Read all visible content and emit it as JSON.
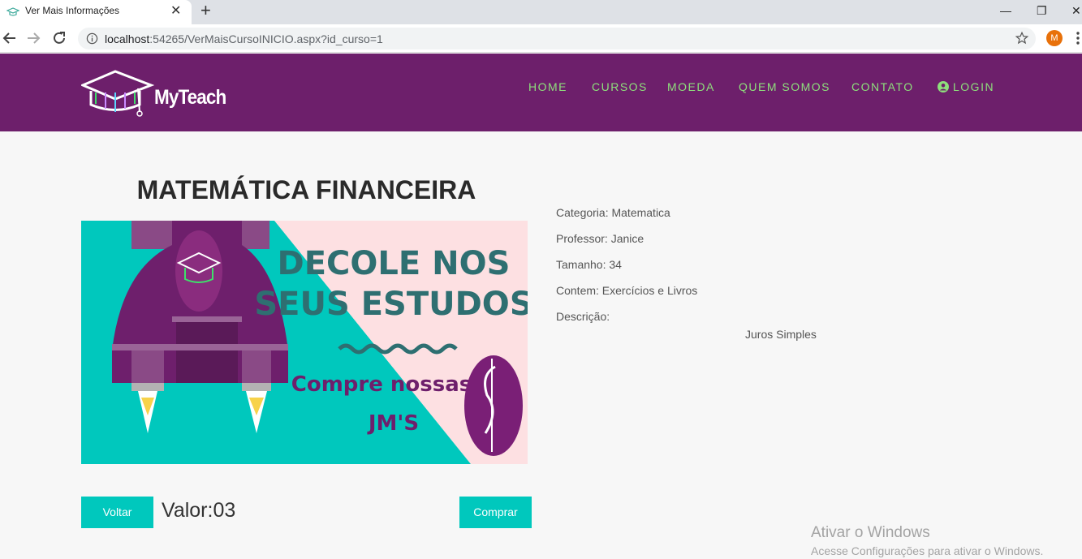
{
  "browser": {
    "tab_title": "Ver Mais Informações",
    "url_host": "localhost",
    "url_path": ":54265/VerMaisCursoINICIO.aspx?id_curso=1",
    "profile_initial": "M"
  },
  "header": {
    "logo_text": "MyTeach",
    "nav": [
      "HOME",
      "CURSOS",
      "MOEDA",
      "QUEM SOMOS",
      "CONTATO",
      "LOGIN"
    ],
    "bg_color": "#6d1f6b",
    "nav_color": "#8ee07c"
  },
  "course": {
    "title": "MATEMÁTICA FINANCEIRA",
    "banner": {
      "headline_line1": "DECOLE NOS",
      "headline_line2": "SEUS ESTUDOS",
      "subline1": "Compre nossas",
      "subline2": "JM'S"
    },
    "details": {
      "categoria": "Categoria: Matematica",
      "professor": "Professor: Janice",
      "tamanho": "Tamanho: 34",
      "contem": "Contem: Exercícios e Livros",
      "descricao_label": "Descrição:",
      "descricao_text": "Juros Simples"
    },
    "valor": "Valor:03"
  },
  "actions": {
    "voltar": "Voltar",
    "comprar": "Comprar",
    "accent_color": "#00c8bd"
  },
  "windows_watermark": {
    "line1": "Ativar o Windows",
    "line2": "Acesse Configurações para ativar o Windows."
  }
}
